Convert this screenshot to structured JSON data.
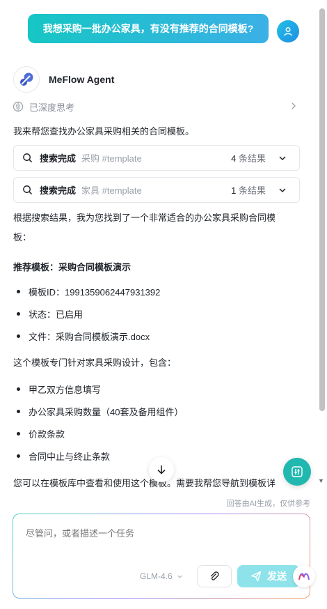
{
  "user_message": "我想采购一批办公家具，有没有推荐的合同模板?",
  "agent": {
    "name": "MeFlow Agent"
  },
  "thinking": {
    "label": "已深度思考"
  },
  "intro": "我来帮您查找办公家具采购相关的合同模板。",
  "searches": [
    {
      "status": "搜索完成",
      "keyword": "采购 #template",
      "count": "4",
      "count_suffix": "条结果"
    },
    {
      "status": "搜索完成",
      "keyword": "家具 #template",
      "count": "1",
      "count_suffix": "条结果"
    }
  ],
  "result_text_line1": "根据搜索结果，我为您找到了一个非常适合的办公家具采购合同模",
  "result_text_line2": "板：",
  "recommend_heading": "推荐模板：采购合同模板演示",
  "template_details": [
    "模板ID：1991359062447931392",
    "状态：已启用",
    "文件：采购合同模板演示.docx"
  ],
  "design_intro": "这个模板专门针对家具采购设计，包含：",
  "features": [
    "甲乙双方信息填写",
    "办公家具采购数量（40套及备用组件）",
    "价款条款",
    "合同中止与终止条款"
  ],
  "closing_text": "您可以在模板库中查看和使用这个模板。需要我帮您导航到模板详",
  "disclaimer": "回答由AI生成，仅供参考",
  "composer": {
    "placeholder": "尽管问，或者描述一个任务",
    "model": "GLM-4.6",
    "send_label": "发送"
  },
  "colors": {
    "accent": "#16c6c4",
    "send_disabled": "#8ee3ea",
    "fab": "#21b8b0"
  }
}
